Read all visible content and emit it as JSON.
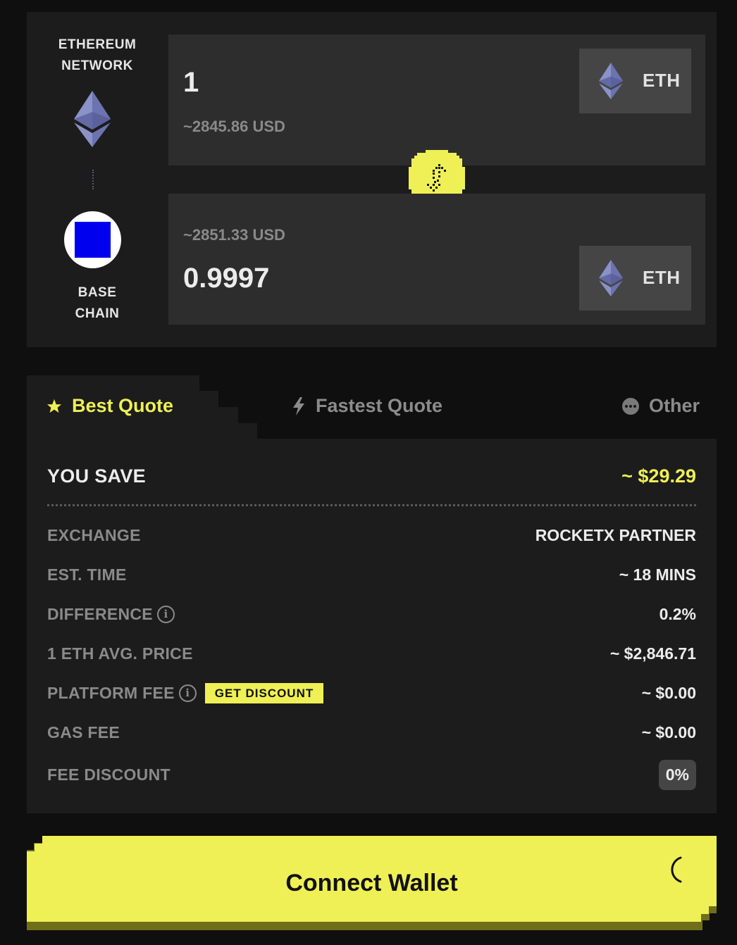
{
  "source_chain": {
    "line1": "ETHEREUM",
    "line2": "NETWORK",
    "icon": "ethereum-icon"
  },
  "destination_chain": {
    "line1": "BASE",
    "line2": "CHAIN",
    "icon": "base-icon"
  },
  "from": {
    "amount": "1",
    "usd": "~2845.86 USD",
    "token": "ETH"
  },
  "to": {
    "amount": "0.9997",
    "usd": "~2851.33 USD",
    "token": "ETH"
  },
  "tabs": {
    "best": "Best Quote",
    "fastest": "Fastest Quote",
    "other": "Other"
  },
  "quote": {
    "save_label": "YOU SAVE",
    "save_value": "~ $29.29",
    "rows": [
      {
        "label": "EXCHANGE",
        "value": "ROCKETX PARTNER"
      },
      {
        "label": "EST. TIME",
        "value": "~ 18 MINS"
      },
      {
        "label": "DIFFERENCE",
        "value": "0.2%"
      },
      {
        "label": "1 ETH AVG. PRICE",
        "value": "~ $2,846.71"
      },
      {
        "label": "PLATFORM FEE",
        "value": "~ $0.00"
      },
      {
        "label": "GAS FEE",
        "value": "~ $0.00"
      },
      {
        "label": "FEE DISCOUNT",
        "value": "0%"
      }
    ],
    "discount_button": "GET DISCOUNT"
  },
  "connect_button": "Connect Wallet",
  "colors": {
    "accent": "#eef055",
    "panel": "#1c1c1c",
    "box": "#2d2d2d",
    "background": "#0f0f0f",
    "base_blue": "#0000ee"
  }
}
